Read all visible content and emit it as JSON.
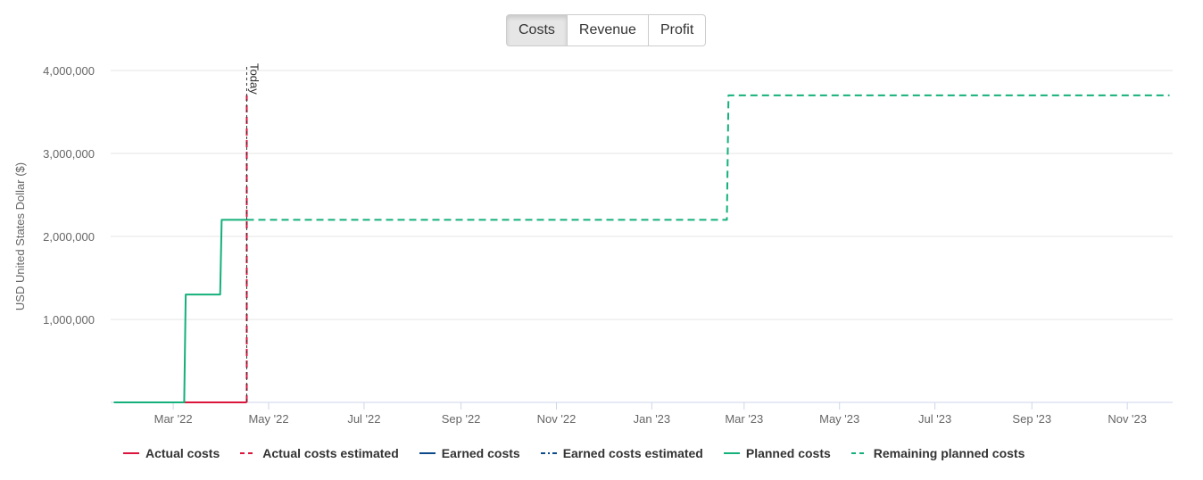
{
  "tabs": [
    {
      "label": "Costs",
      "active": true
    },
    {
      "label": "Revenue",
      "active": false
    },
    {
      "label": "Profit",
      "active": false
    }
  ],
  "chart_data": {
    "type": "line",
    "ylabel": "USD United States Dollar ($)",
    "ylim": [
      0,
      4000000
    ],
    "yticks": [
      {
        "value": 1000000,
        "label": "1,000,000"
      },
      {
        "value": 2000000,
        "label": "2,000,000"
      },
      {
        "value": 3000000,
        "label": "3,000,000"
      },
      {
        "value": 4000000,
        "label": "4,000,000"
      }
    ],
    "xlim": [
      "2022-01-20",
      "2023-11-30"
    ],
    "xticks": [
      {
        "date": "2022-03-01",
        "label": "Mar '22"
      },
      {
        "date": "2022-05-01",
        "label": "May '22"
      },
      {
        "date": "2022-07-01",
        "label": "Jul '22"
      },
      {
        "date": "2022-09-01",
        "label": "Sep '22"
      },
      {
        "date": "2022-11-01",
        "label": "Nov '22"
      },
      {
        "date": "2023-01-01",
        "label": "Jan '23"
      },
      {
        "date": "2023-03-01",
        "label": "Mar '23"
      },
      {
        "date": "2023-05-01",
        "label": "May '23"
      },
      {
        "date": "2023-07-01",
        "label": "Jul '23"
      },
      {
        "date": "2023-09-01",
        "label": "Sep '23"
      },
      {
        "date": "2023-11-01",
        "label": "Nov '23"
      }
    ],
    "today": {
      "date": "2022-04-17",
      "label": "Today"
    },
    "series": [
      {
        "name": "Actual costs",
        "color": "#dc143c",
        "dash": "solid",
        "points": [
          [
            "2022-03-08",
            0
          ],
          [
            "2022-04-17",
            0
          ]
        ]
      },
      {
        "name": "Actual costs estimated",
        "color": "#dc143c",
        "dash": "dash",
        "points": [
          [
            "2022-04-17",
            0
          ],
          [
            "2022-04-17",
            3700000
          ]
        ]
      },
      {
        "name": "Earned costs",
        "color": "#0d4a8a",
        "dash": "solid",
        "points": []
      },
      {
        "name": "Earned costs estimated",
        "color": "#0d4a8a",
        "dash": "dashdot",
        "points": []
      },
      {
        "name": "Planned costs",
        "color": "#14b07a",
        "dash": "solid",
        "points": [
          [
            "2022-01-22",
            0
          ],
          [
            "2022-03-08",
            0
          ],
          [
            "2022-03-09",
            1300000
          ],
          [
            "2022-03-31",
            1300000
          ],
          [
            "2022-04-01",
            2200000
          ],
          [
            "2022-04-17",
            2200000
          ]
        ]
      },
      {
        "name": "Remaining planned costs",
        "color": "#14b07a",
        "dash": "dash",
        "points": [
          [
            "2022-04-17",
            2200000
          ],
          [
            "2023-02-18",
            2200000
          ],
          [
            "2023-02-19",
            3700000
          ],
          [
            "2023-11-28",
            3700000
          ]
        ]
      }
    ]
  }
}
